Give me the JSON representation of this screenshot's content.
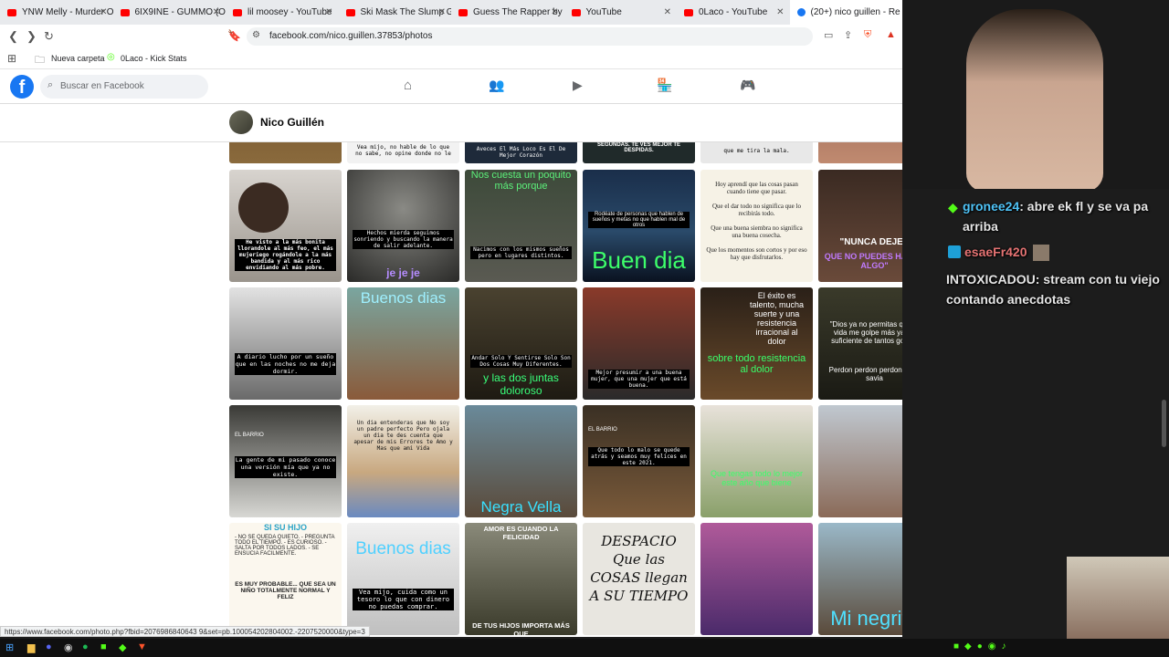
{
  "tabs": [
    {
      "label": "YNW Melly - Murder On M",
      "color": "#ff0000"
    },
    {
      "label": "6IX9INE - GUMMO (OFFIC",
      "color": "#ff0000"
    },
    {
      "label": "lil moosey - YouTube",
      "color": "#ff0000"
    },
    {
      "label": "Ski Mask The Slump God",
      "color": "#ff0000"
    },
    {
      "label": "Guess The Rapper by Emo",
      "color": "#ff0000"
    },
    {
      "label": "YouTube",
      "color": "#ff0000"
    },
    {
      "label": "0Laco - YouTube",
      "color": "#ff0000"
    },
    {
      "label": "(20+) nico guillen - Re",
      "color": "#1877f2"
    }
  ],
  "address": {
    "url": "facebook.com/nico.guillen.37853/photos"
  },
  "bookmarks": {
    "folder": "Nueva carpeta",
    "kick": "0Laco - Kick Stats"
  },
  "facebook": {
    "search_placeholder": "Buscar en Facebook",
    "profile_name": "Nico Guillén"
  },
  "photos": {
    "row0": [
      "",
      "Vea mijo, no hable de lo que no sabe, no opine donde no le",
      "Aveces El Más Loco Es El De Mejor Corazón",
      "SEGUNDAS. TE VES MEJOR TE DESPIDAS.",
      "que me tira la mala.",
      ""
    ],
    "r1c1": "He visto a la más bonita llorandole al más feo, el más mujeriego rogándole a la más bandida y al más rico envidiando al más pobre.",
    "r1c2a": "Hechos mierda seguimos sonriendo y buscando la manera de salir adelante.",
    "r1c2b": "je je je",
    "r1c3a": "Nos cuesta un poquito más porque",
    "r1c3b": "Nacimos con los mismos sueños pero en lugares distintos.",
    "r1c4a": "Rodéate de personas que hablen de sueños y metas no que hablen mal de otros",
    "r1c4b": "Buen dia",
    "r1c5a": "Hoy aprendí que las cosas pasan cuando tiene que pasar.",
    "r1c5b": "Que el dar todo no significa que lo recibirás todo.",
    "r1c5c": "Que una buena siembra no significa una buena cosecha.",
    "r1c5d": "Que los momentos son cortos y por eso hay que disfrutarlos.",
    "r1c6a": "\"NUNCA DEJES",
    "r1c6b": "QUE NO PUEDES HACER ALGO\"",
    "r2c1": "A diario lucho por un sueño que en las noches no me deja dormir.",
    "r2c2": "Buenos dias",
    "r2c3a": "Andar Solo Y Sentirse Solo Son Dos Cosas Muy Diferentes.",
    "r2c3b": "y las dos juntas doloroso",
    "r2c4": "Mejor presumir a una buena mujer, que una mujer que está buena.",
    "r2c5a": "El éxito es talento, mucha suerte y una resistencia irracional al dolor",
    "r2c5b": "sobre todo resistencia al dolor",
    "r2c6a": "\"Dios ya no permitas que la vida me golpe más ya Es suficiente de tantos golpes",
    "r2c6b": "Perdon perdon perdon no lo savia",
    "r3c1a": "EL BARRIO",
    "r3c1b": "La gente de mi pasado conoce una versión mía que ya no existe.",
    "r3c2": "Un dia entenderas que No soy un padre perfecto Pero ojala un dia te des cuenta que apesar de mis Errores te Amo y Mas que ami Vida",
    "r3c3": "Negra Vella",
    "r3c4a": "EL BARRIO",
    "r3c4b": "Que todo lo malo se quede atrás y seamos muy felices en este 2021.",
    "r3c5": "Que tengas todo lo mejor este año que biene",
    "r4c1a": "SI SU HIJO",
    "r4c1b": "- NO SE QUEDA QUIETO. - PREGUNTA TODO EL TIEMPO. - ES CURIOSO. - SALTA POR TODOS LADOS. - SE ENSUCIA FACILMENTE.",
    "r4c1c": "ES MUY PROBABLE... QUE SEA UN NIÑO TOTALMENTE NORMAL Y FELIZ",
    "r4c2a": "Buenos dias",
    "r4c2b": "Vea mijo, cuida como un tesoro lo que con dinero no puedas comprar.",
    "r4c3a": "AMOR ES CUANDO LA FELICIDAD",
    "r4c3b": "DE TUS HIJOS IMPORTA MÁS QUE",
    "r4c4": "DESPACIO Que las COSAS llegan A SU TIEMPO",
    "r4c6": "Mi negrita"
  },
  "status_url": "https://www.facebook.com/photo.php?fbid=2076986840643 9&set=pb.100054202804002.-2207520000&type=3",
  "chat": [
    {
      "user": "gronee24",
      "text": ": abre ek fl y se va pa arriba",
      "user_color": "#4fc3f7"
    },
    {
      "user": "esaeFr420",
      "text": "",
      "user_color": "#e57373"
    },
    {
      "user": "INTOXICADOU",
      "text": ": stream con tu viejo contando anecdotas",
      "user_color": "#e6e6e6"
    }
  ],
  "colors": {
    "fb_blue": "#1877f2",
    "chat_bg": "#1c1c1c"
  }
}
